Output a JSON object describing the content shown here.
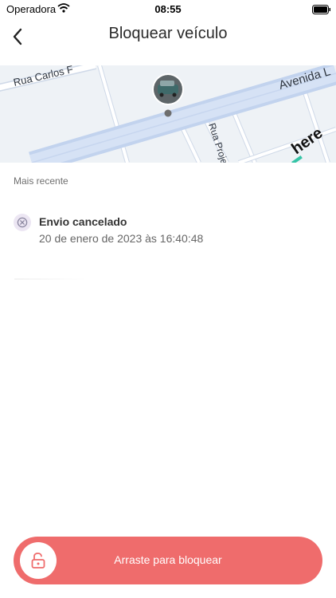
{
  "status": {
    "carrier": "Operadora",
    "time": "08:55"
  },
  "header": {
    "title": "Bloquear veículo",
    "back_icon": "chevron-left-icon"
  },
  "map": {
    "streets": [
      "Rua Carlos F",
      "Avenida L",
      "Rua Proje"
    ],
    "brand": "here",
    "marker_icon": "vehicle-avatar"
  },
  "history": {
    "section_label": "Mais recente",
    "events": [
      {
        "title": "Envio cancelado",
        "timestamp": "20 de enero de 2023 às 16:40:48",
        "icon": "cancel-icon"
      }
    ]
  },
  "lock_slider": {
    "label": "Arraste para bloquear",
    "icon": "unlock-icon",
    "color": "#ef6c6c"
  }
}
